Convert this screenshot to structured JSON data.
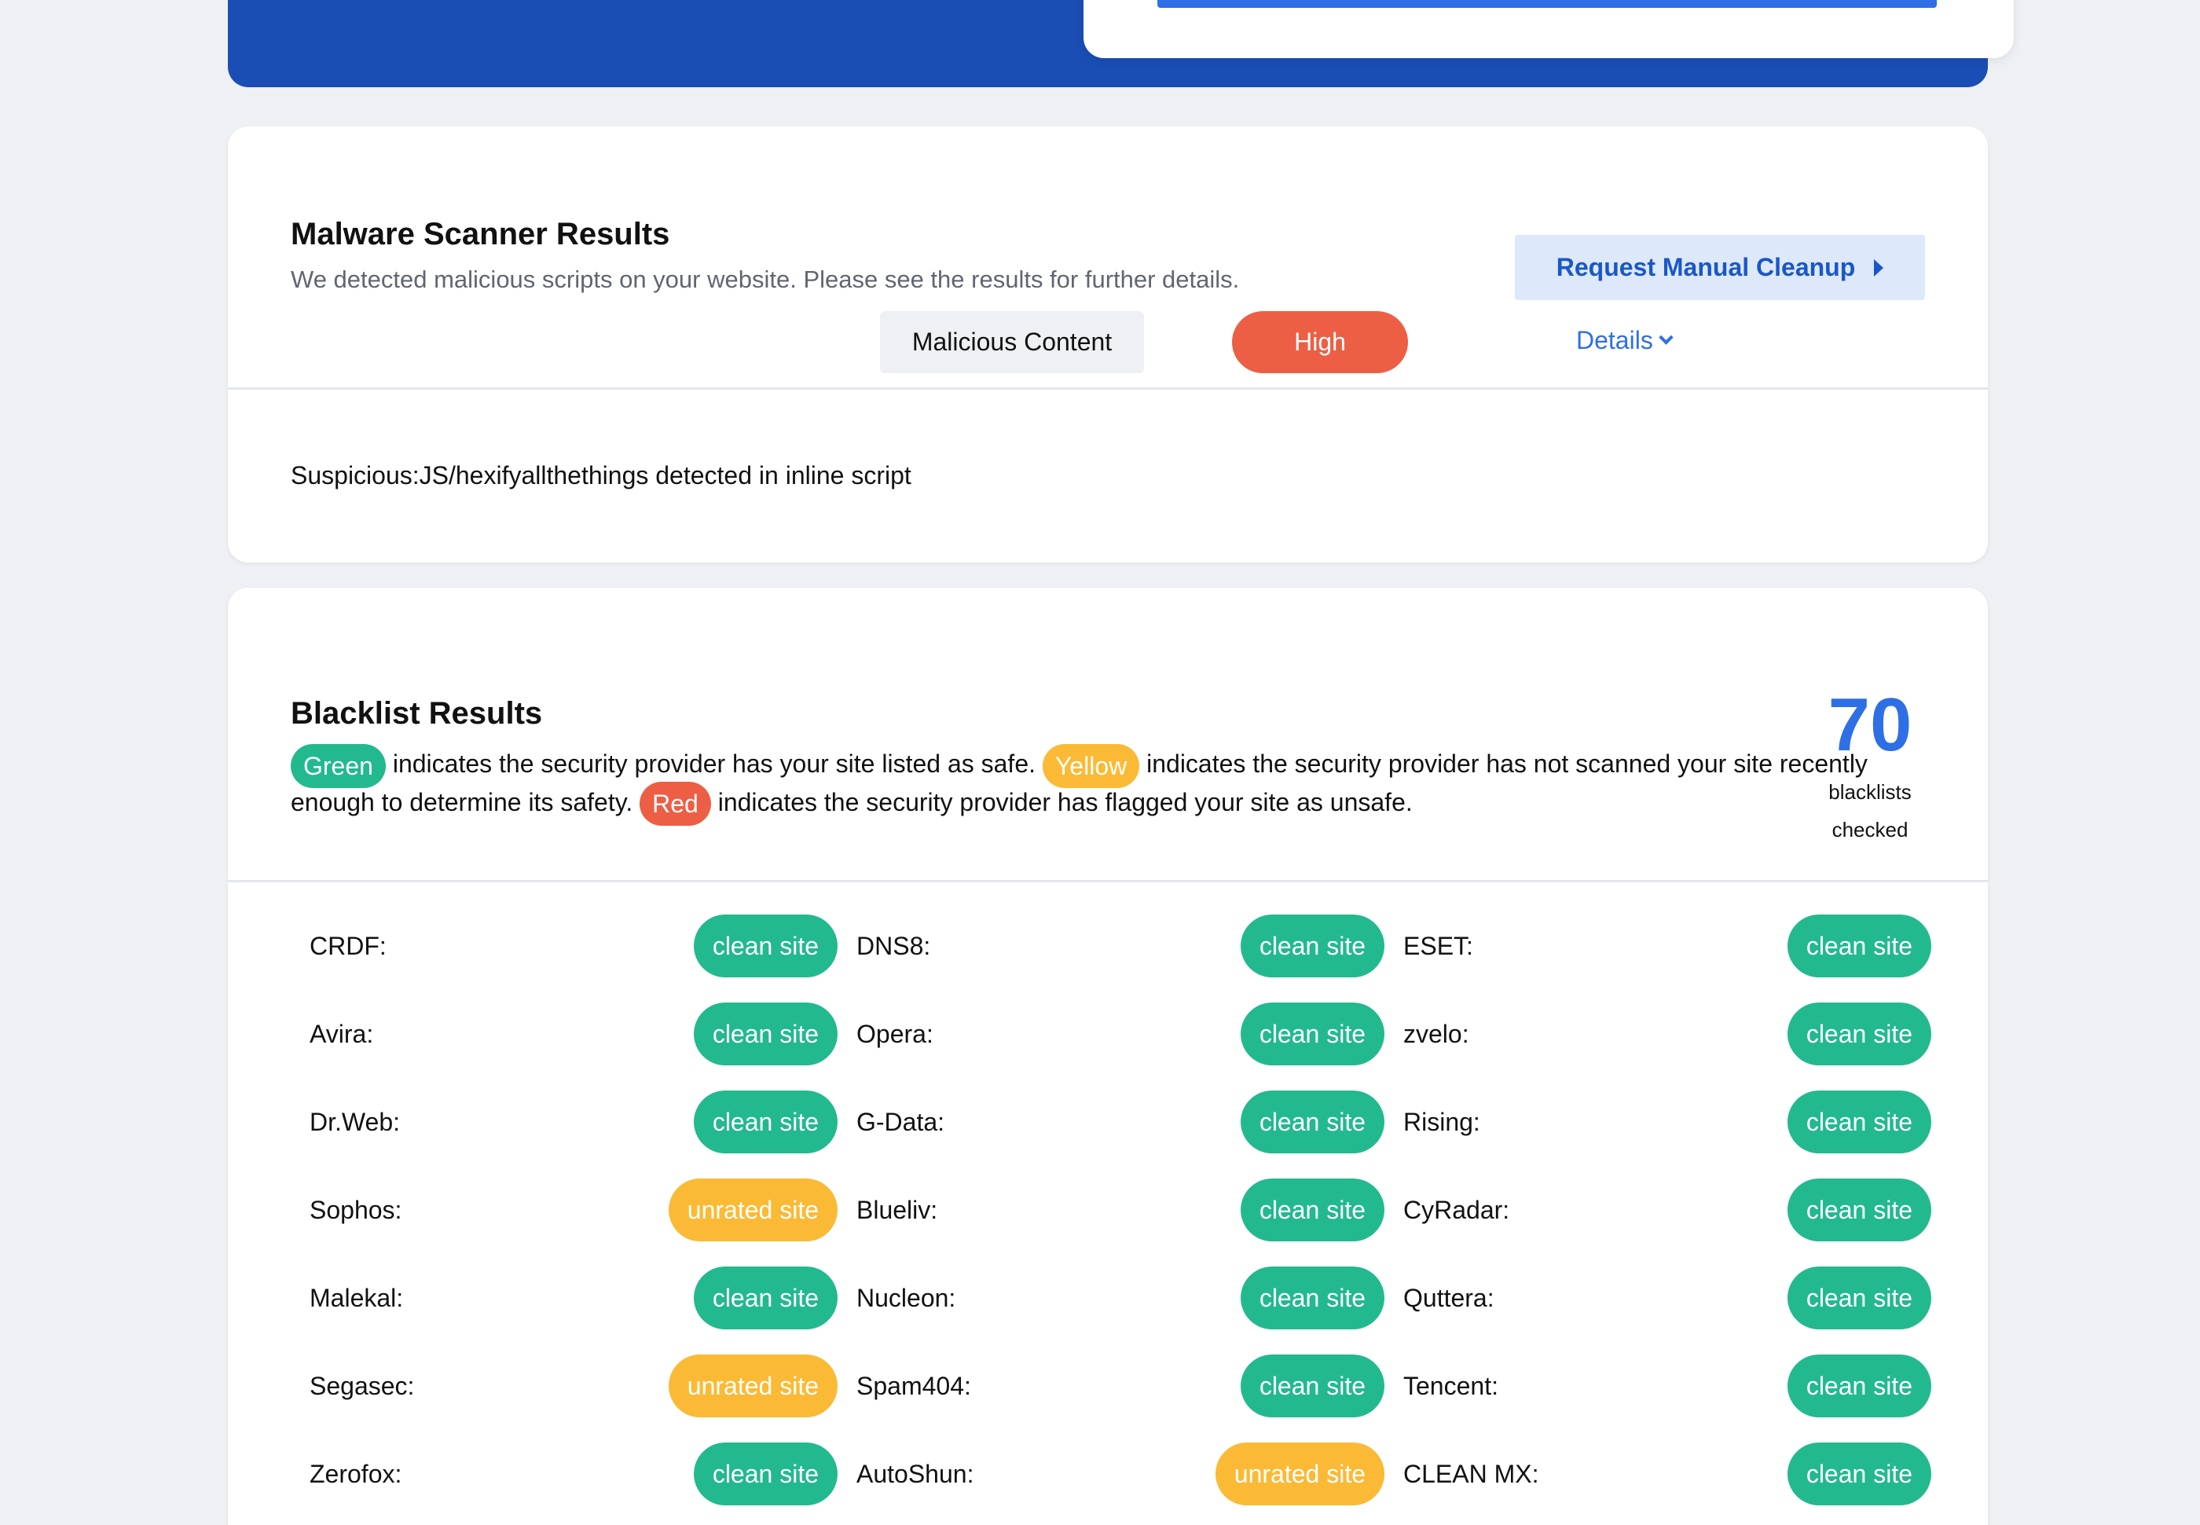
{
  "malware": {
    "title": "Malware Scanner Results",
    "subtitle": "We detected malicious scripts on your website. Please see the results for further details.",
    "cleanup_button": "Request Manual Cleanup",
    "threat": {
      "description": "Suspicious:JS/hexifyallthethings detected in inline script",
      "category": "Malicious Content",
      "severity": "High",
      "details_label": "Details"
    }
  },
  "blacklist": {
    "title": "Blacklist Results",
    "legend": {
      "green": "Green",
      "green_text": "indicates the security provider has your site listed as safe.",
      "yellow": "Yellow",
      "yellow_text": "indicates the security provider has not scanned your site recently enough to determine its safety.",
      "red": "Red",
      "red_text": "indicates the security provider has flagged your site as unsafe."
    },
    "count": "70",
    "count_label_1": "blacklists",
    "count_label_2": "checked",
    "items": [
      {
        "name": "CRDF:",
        "status": "clean site",
        "kind": "clean"
      },
      {
        "name": "DNS8:",
        "status": "clean site",
        "kind": "clean"
      },
      {
        "name": "ESET:",
        "status": "clean site",
        "kind": "clean"
      },
      {
        "name": "Avira:",
        "status": "clean site",
        "kind": "clean"
      },
      {
        "name": "Opera:",
        "status": "clean site",
        "kind": "clean"
      },
      {
        "name": "zvelo:",
        "status": "clean site",
        "kind": "clean"
      },
      {
        "name": "Dr.Web:",
        "status": "clean site",
        "kind": "clean"
      },
      {
        "name": "G-Data:",
        "status": "clean site",
        "kind": "clean"
      },
      {
        "name": "Rising:",
        "status": "clean site",
        "kind": "clean"
      },
      {
        "name": "Sophos:",
        "status": "unrated site",
        "kind": "unrated"
      },
      {
        "name": "Blueliv:",
        "status": "clean site",
        "kind": "clean"
      },
      {
        "name": "CyRadar:",
        "status": "clean site",
        "kind": "clean"
      },
      {
        "name": "Malekal:",
        "status": "clean site",
        "kind": "clean"
      },
      {
        "name": "Nucleon:",
        "status": "clean site",
        "kind": "clean"
      },
      {
        "name": "Quttera:",
        "status": "clean site",
        "kind": "clean"
      },
      {
        "name": "Segasec:",
        "status": "unrated site",
        "kind": "unrated"
      },
      {
        "name": "Spam404:",
        "status": "clean site",
        "kind": "clean"
      },
      {
        "name": "Tencent:",
        "status": "clean site",
        "kind": "clean"
      },
      {
        "name": "Zerofox:",
        "status": "clean site",
        "kind": "clean"
      },
      {
        "name": "AutoShun:",
        "status": "unrated site",
        "kind": "unrated"
      },
      {
        "name": "CLEAN MX:",
        "status": "clean site",
        "kind": "clean"
      }
    ]
  }
}
